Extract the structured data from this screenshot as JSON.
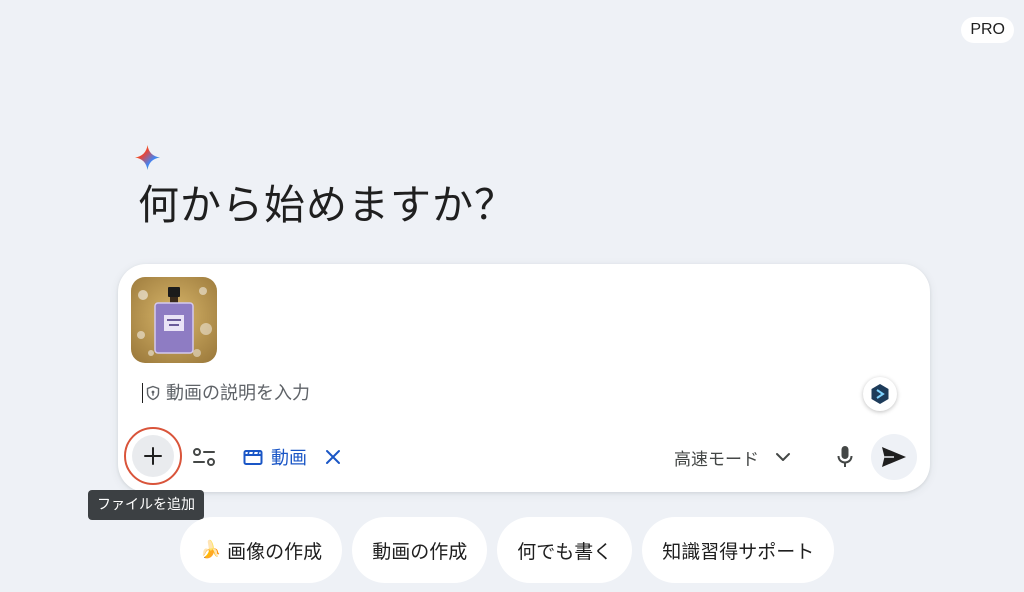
{
  "header": {
    "badge": "PRO"
  },
  "greeting": {
    "title": "何から始めますか？"
  },
  "composer": {
    "attachment": {
      "icon": "perfume-bottle-image"
    },
    "prompt": {
      "placeholder": "動画の説明を入力",
      "value": ""
    },
    "tools": {
      "add_icon": "plus-icon",
      "tools_icon": "tune-icon",
      "active_tool": {
        "icon": "clapperboard-icon",
        "label": "動画",
        "close_icon": "close-icon"
      },
      "mode": {
        "label": "高速モード",
        "icon": "chevron-down-icon"
      },
      "mic_icon": "mic-icon",
      "send_icon": "send-icon"
    }
  },
  "tooltip": {
    "text": "ファイルを追加"
  },
  "suggestions": [
    {
      "emoji": "🍌",
      "label": "画像の作成"
    },
    {
      "label": "動画の作成"
    },
    {
      "label": "何でも書く"
    },
    {
      "label": "知識習得サポート"
    }
  ],
  "colors": {
    "background": "#eef1f6",
    "accent_blue": "#1a56c6",
    "highlight_ring": "#d9543a",
    "tooltip_bg": "#3c4043"
  }
}
